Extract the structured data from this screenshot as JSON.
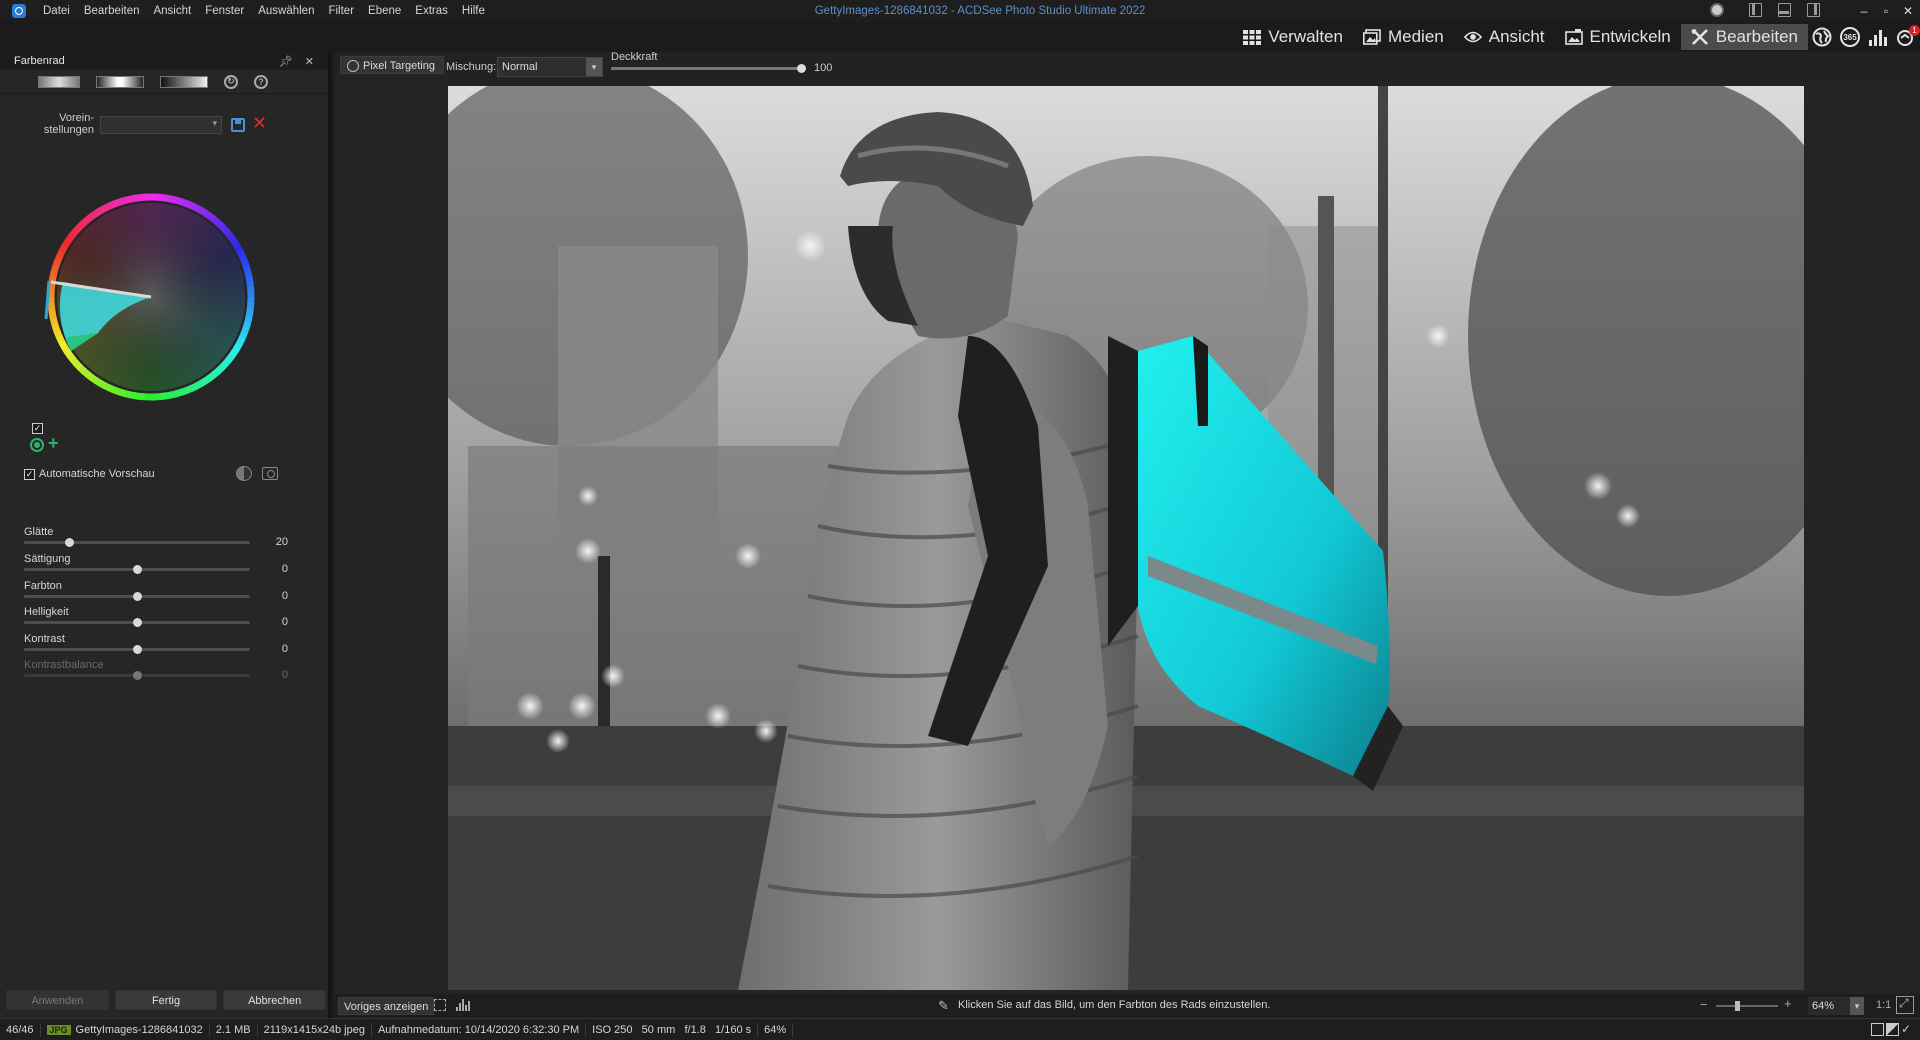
{
  "app": {
    "window_title": "GettyImages-1286841032 - ACDSee Photo Studio Ultimate 2022",
    "menu": [
      "Datei",
      "Bearbeiten",
      "Ansicht",
      "Fenster",
      "Auswählen",
      "Filter",
      "Ebene",
      "Extras",
      "Hilfe"
    ],
    "window_controls": {
      "minimize": "–",
      "restore": "▫",
      "close": "✕"
    }
  },
  "modes": [
    {
      "label": "Verwalten",
      "icon": "grid-icon",
      "active": false
    },
    {
      "label": "Medien",
      "icon": "media-icon",
      "active": false
    },
    {
      "label": "Ansicht",
      "icon": "eye-icon",
      "active": false
    },
    {
      "label": "Entwickeln",
      "icon": "develop-icon",
      "active": false
    },
    {
      "label": "Bearbeiten",
      "icon": "tools-icon",
      "active": true
    }
  ],
  "mode_extras": {
    "acdsee365_label": "365",
    "notification_count": "1"
  },
  "panel": {
    "title": "Farbenrad",
    "presets_label": "Vorein-\nstellungen",
    "presets_value": "",
    "color_wheel": {
      "selected_hue_deg": 180,
      "accent": "#3fd6e0"
    },
    "enabled": true,
    "auto_preview_label": "Automatische Vorschau",
    "auto_preview_checked": true,
    "sliders": [
      {
        "label": "Glätte",
        "value": "20",
        "fraction": 0.2,
        "disabled": false
      },
      {
        "label": "Sättigung",
        "value": "0",
        "fraction": 0.5,
        "disabled": false
      },
      {
        "label": "Farbton",
        "value": "0",
        "fraction": 0.5,
        "disabled": false
      },
      {
        "label": "Helligkeit",
        "value": "0",
        "fraction": 0.5,
        "disabled": false
      },
      {
        "label": "Kontrast",
        "value": "0",
        "fraction": 0.5,
        "disabled": false
      },
      {
        "label": "Kontrastbalance",
        "value": "0",
        "fraction": 0.5,
        "disabled": true
      }
    ],
    "buttons": {
      "apply": "Anwenden",
      "done": "Fertig",
      "cancel": "Abbrechen"
    }
  },
  "options": {
    "pixel_targeting": "Pixel Targeting",
    "blend_label": "Mischung:",
    "blend_value": "Normal",
    "opacity_label": "Deckkraft",
    "opacity_value": "100",
    "opacity_fraction": 1.0
  },
  "bottom": {
    "prev_button": "Voriges anzeigen",
    "hint": "Klicken Sie auf das Bild, um den Farbton des Rads einzustellen.",
    "zoom_value": "64%",
    "zoom_fraction": 0.3,
    "one_to_one": "1:1"
  },
  "status": {
    "position": "46/46",
    "format": "JPG",
    "filename": "GettyImages-1286841032",
    "size": "2.1 MB",
    "dimensions": "2119x1415x24b jpeg",
    "date": "Aufnahmedatum: 10/14/2020 6:32:30 PM",
    "exif": "ISO 250   50 mm   f/1.8   1/160 s",
    "zoom": "64%"
  }
}
